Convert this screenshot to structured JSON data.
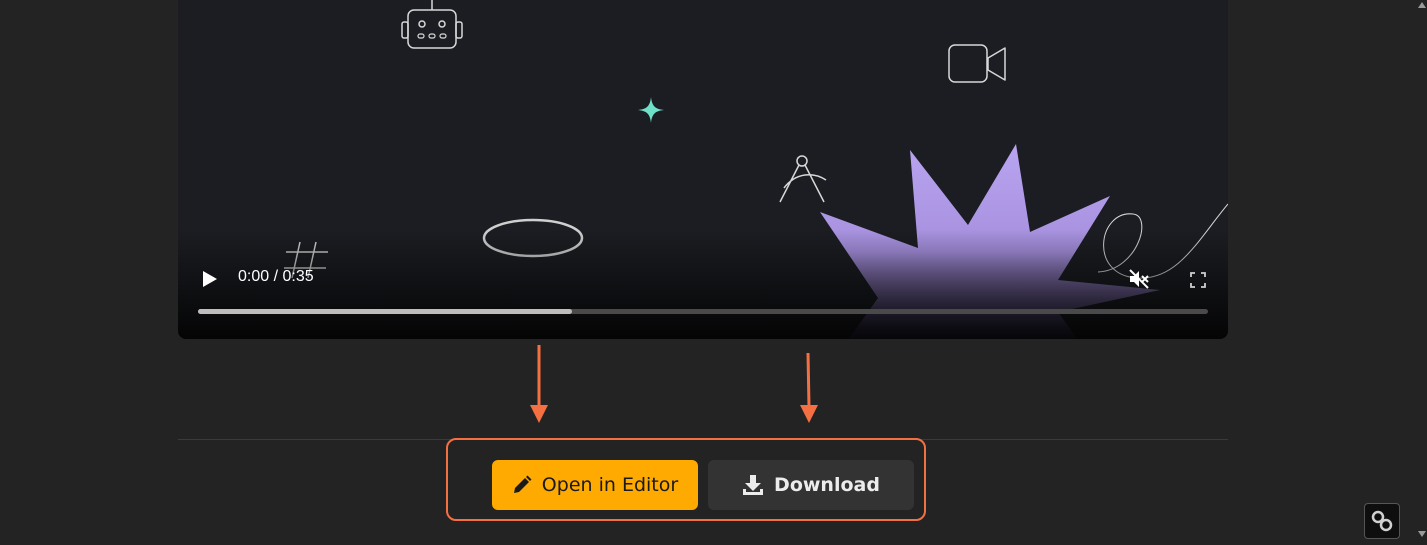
{
  "video": {
    "time_display": "0:00 / 0:35",
    "progress": 0.37,
    "muted": true,
    "icons": [
      "robot-icon",
      "video-camera-icon",
      "sparkle-icon",
      "compass-icon",
      "hashtag-icon",
      "ellipse-shape",
      "starburst-shape"
    ]
  },
  "actions": {
    "open_editor_label": "Open in Editor",
    "download_label": "Download"
  },
  "colors": {
    "accent": "#ffaa00",
    "highlight": "#f47042",
    "starburst": "#b9a4f0"
  }
}
